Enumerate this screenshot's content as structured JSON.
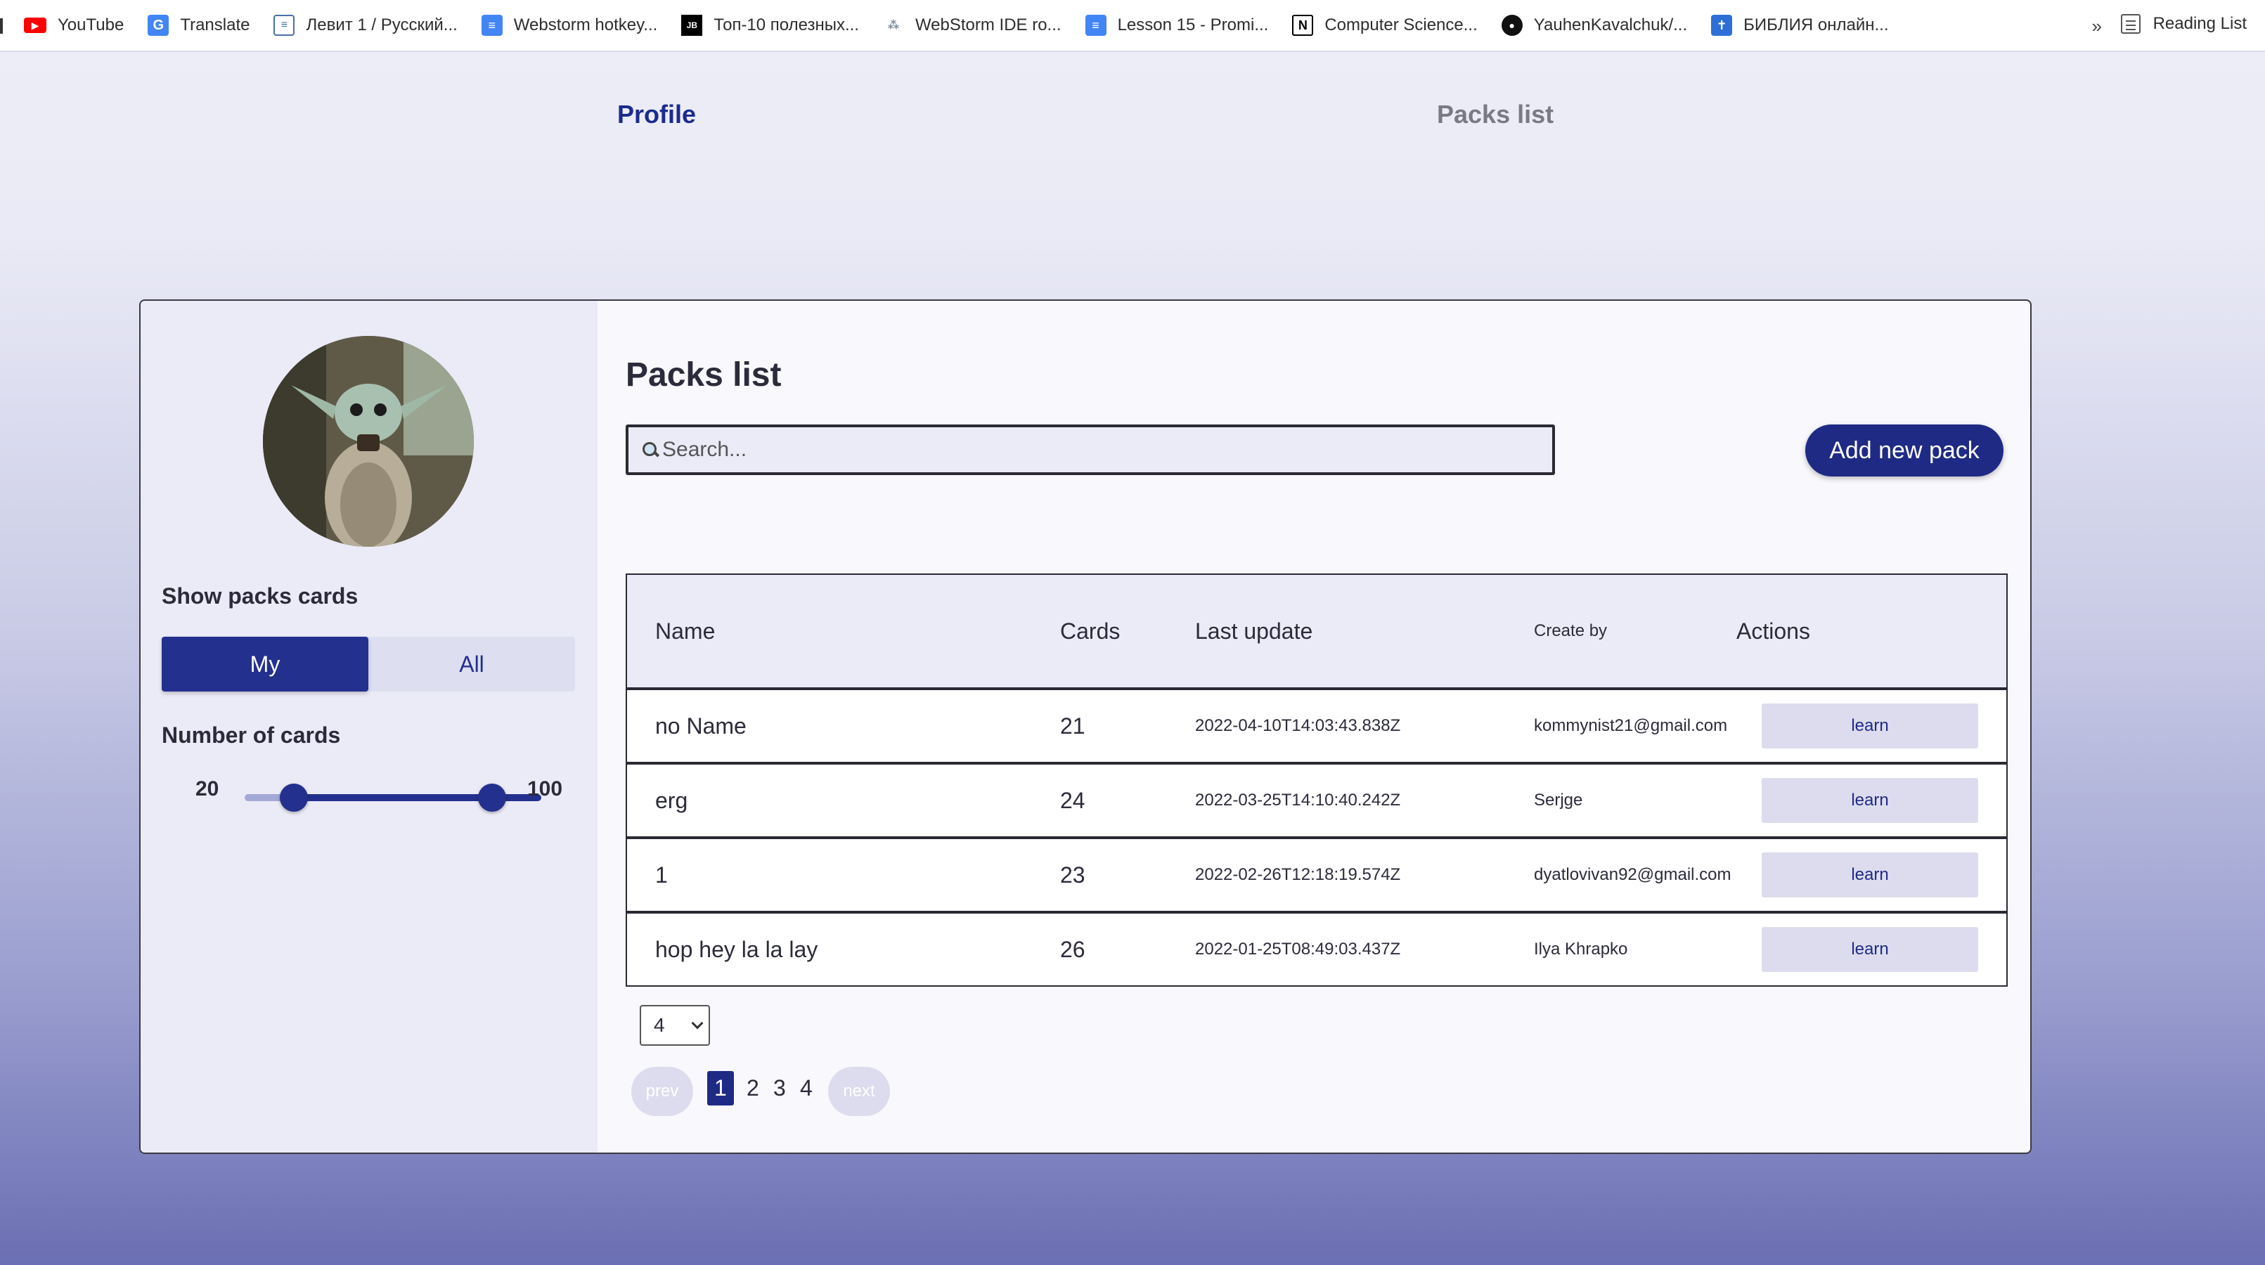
{
  "bookmarks": [
    {
      "label": "YouTube",
      "icon": "youtube-icon"
    },
    {
      "label": "Translate",
      "icon": "translate-icon"
    },
    {
      "label": "Левит 1 / Русский...",
      "icon": "document-icon"
    },
    {
      "label": "Webstorm hotkey...",
      "icon": "docs-icon"
    },
    {
      "label": "Топ-10 полезных...",
      "icon": "jetbrains-icon"
    },
    {
      "label": "WebStorm IDE ro...",
      "icon": "dots-icon"
    },
    {
      "label": "Lesson 15 - Promi...",
      "icon": "docs-icon"
    },
    {
      "label": "Computer Science...",
      "icon": "notion-icon"
    },
    {
      "label": "YauhenKavalchuk/...",
      "icon": "github-icon"
    },
    {
      "label": "БИБЛИЯ онлайн...",
      "icon": "bible-icon"
    }
  ],
  "bookmarks_more": "»",
  "reading_list": "Reading List",
  "nav": {
    "profile": "Profile",
    "packs_list": "Packs list"
  },
  "sidebar": {
    "show_packs_title": "Show packs cards",
    "toggle_my": "My",
    "toggle_all": "All",
    "number_title": "Number of cards",
    "range_min": "20",
    "range_max": "100"
  },
  "content": {
    "title": "Packs list",
    "search_placeholder": "Search...",
    "add_button": "Add new pack"
  },
  "table": {
    "headers": {
      "name": "Name",
      "cards": "Cards",
      "last_update": "Last update",
      "created_by": "Create by",
      "actions": "Actions"
    },
    "rows": [
      {
        "name": "no Name",
        "cards": "21",
        "updated": "2022-04-10T14:03:43.838Z",
        "by": "kommynist21@gmail.com",
        "action": "learn"
      },
      {
        "name": "erg",
        "cards": "24",
        "updated": "2022-03-25T14:10:40.242Z",
        "by": "Serjge",
        "action": "learn"
      },
      {
        "name": "1",
        "cards": "23",
        "updated": "2022-02-26T12:18:19.574Z",
        "by": "dyatlovivan92@gmail.com",
        "action": "learn"
      },
      {
        "name": "hop hey la la lay",
        "cards": "26",
        "updated": "2022-01-25T08:49:03.437Z",
        "by": "Ilya Khrapko",
        "action": "learn"
      }
    ]
  },
  "pagination": {
    "page_size": "4",
    "prev": "prev",
    "next": "next",
    "pages": [
      "1",
      "2",
      "3",
      "4"
    ],
    "current": "1"
  },
  "colors": {
    "accent": "#1f2a85",
    "accent_light": "#dcdcee",
    "text": "#2b2b3b"
  }
}
